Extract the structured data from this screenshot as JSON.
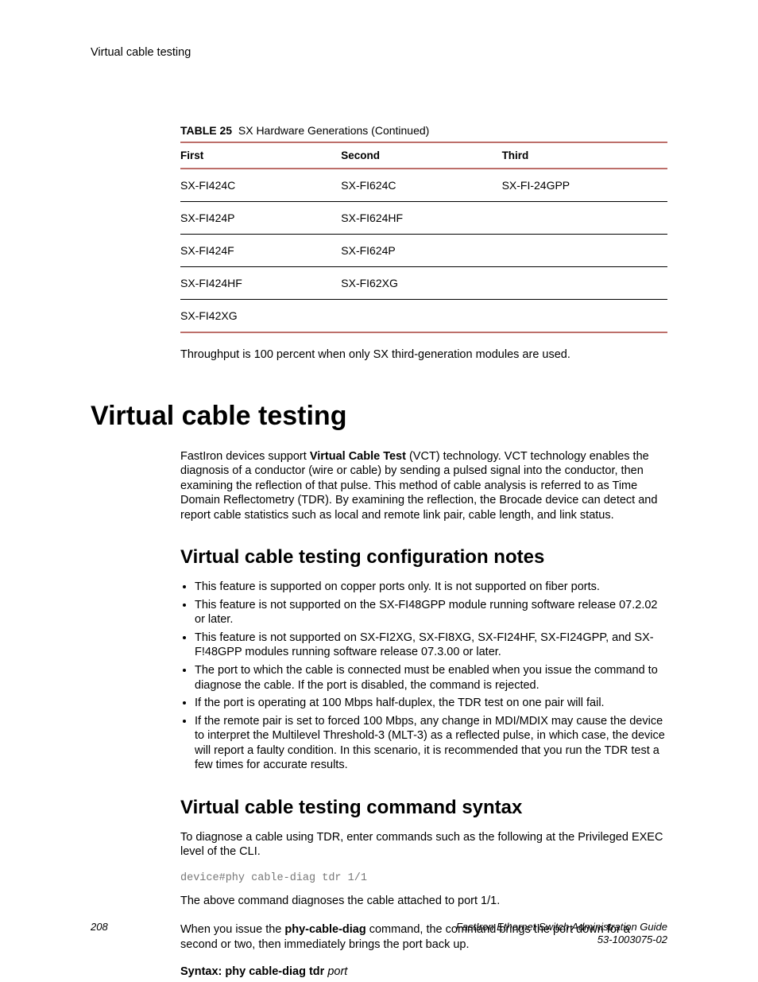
{
  "running_head": "Virtual cable testing",
  "table": {
    "caption_label": "TABLE 25",
    "caption_text": "SX Hardware Generations (Continued)",
    "headers": [
      "First",
      "Second",
      "Third"
    ],
    "rows": [
      [
        "SX-FI424C",
        "SX-FI624C",
        "SX-FI-24GPP"
      ],
      [
        "SX-FI424P",
        "SX-FI624HF",
        ""
      ],
      [
        "SX-FI424F",
        "SX-FI624P",
        ""
      ],
      [
        "SX-FI424HF",
        "SX-FI62XG",
        ""
      ],
      [
        "SX-FI42XG",
        "",
        ""
      ]
    ]
  },
  "throughput_note": "Throughput is 100 percent when only SX third-generation modules are used.",
  "h1": "Virtual cable testing",
  "intro_pre": "FastIron devices support ",
  "intro_bold": "Virtual Cable Test",
  "intro_post": " (VCT) technology. VCT technology enables the diagnosis of a conductor (wire or cable) by sending a pulsed signal into the conductor, then examining the reflection of that pulse. This method of cable analysis is referred to as Time Domain Reflectometry (TDR). By examining the reflection, the Brocade device can detect and report cable statistics such as local and remote link pair, cable length, and link status.",
  "h2a": "Virtual cable testing configuration notes",
  "bullets": [
    "This feature is supported on copper ports only. It is not supported on fiber ports.",
    "This feature is not supported on the SX-FI48GPP module running software release 07.2.02 or later.",
    "This feature is not supported on SX-FI2XG, SX-FI8XG, SX-FI24HF, SX-FI24GPP, and SX-F!48GPP modules running software release 07.3.00 or later.",
    "The port to which the cable is connected must be enabled when you issue the command to diagnose the cable. If the port is disabled, the command is rejected.",
    "If the port is operating at 100 Mbps half-duplex, the TDR test on one pair will fail.",
    "If the remote pair is set to forced 100 Mbps, any change in MDI/MDIX may cause the device to interpret the Multilevel Threshold-3 (MLT-3) as a reflected pulse, in which case, the device will report a faulty condition. In this scenario, it is recommended that you run the TDR test a few times for accurate results."
  ],
  "h2b": "Virtual cable testing command syntax",
  "cmd_intro": "To diagnose a cable using TDR, enter commands such as the following at the Privileged EXEC level of the CLI.",
  "code": "device#phy cable-diag tdr 1/1",
  "cmd_after": "The above command diagnoses the cable attached to port 1/1.",
  "cmd_note_pre": "When you issue the ",
  "cmd_note_bold": "phy-cable-diag",
  "cmd_note_post": " command, the command brings the port down for a second or two, then immediately brings the port back up.",
  "syntax_label": "Syntax: phy cable-diag tdr ",
  "syntax_arg": "port",
  "footer": {
    "page": "208",
    "title": "FastIron Ethernet Switch Administration Guide",
    "docnum": "53-1003075-02"
  }
}
